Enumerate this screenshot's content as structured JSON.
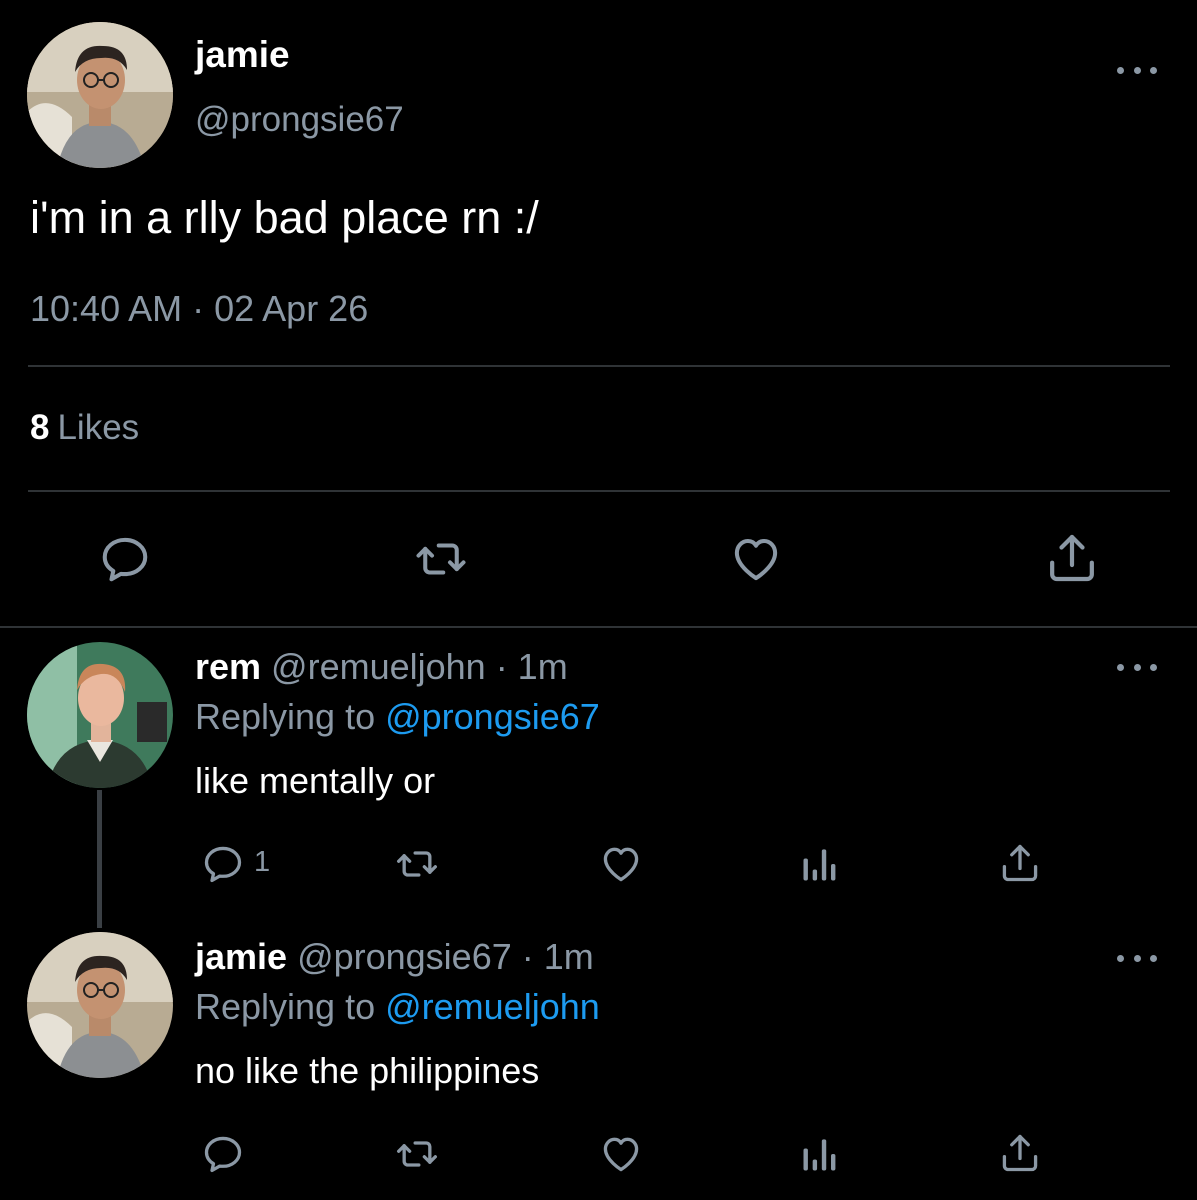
{
  "tweet": {
    "author_name": "jamie",
    "author_handle": "@prongsie67",
    "text": "i'm in a rlly bad place rn :/",
    "timestamp": "10:40 AM · 02 Apr 26",
    "likes_count": "8",
    "likes_label": "Likes",
    "actions": [
      "reply-icon",
      "retweet-icon",
      "like-icon",
      "share-icon"
    ]
  },
  "replies": [
    {
      "name": "rem",
      "handle_time": "@remueljohn · 1m",
      "replying_label": "Replying to",
      "replying_to": "@prongsie67",
      "text": "like mentally or",
      "reply_count": "1",
      "actions": [
        "reply-icon",
        "retweet-icon",
        "like-icon",
        "analytics-icon",
        "share-icon"
      ]
    },
    {
      "name": "jamie",
      "handle_time": "@prongsie67 · 1m",
      "replying_label": "Replying to",
      "replying_to": "@remueljohn",
      "text": "no like the philippines",
      "actions": [
        "reply-icon",
        "retweet-icon",
        "like-icon",
        "analytics-icon",
        "share-icon"
      ]
    }
  ],
  "colors": {
    "background": "#000000",
    "primary_text": "#ffffff",
    "secondary_text": "#8b98a5",
    "link": "#1d9bf0",
    "divider": "#2f3336"
  }
}
